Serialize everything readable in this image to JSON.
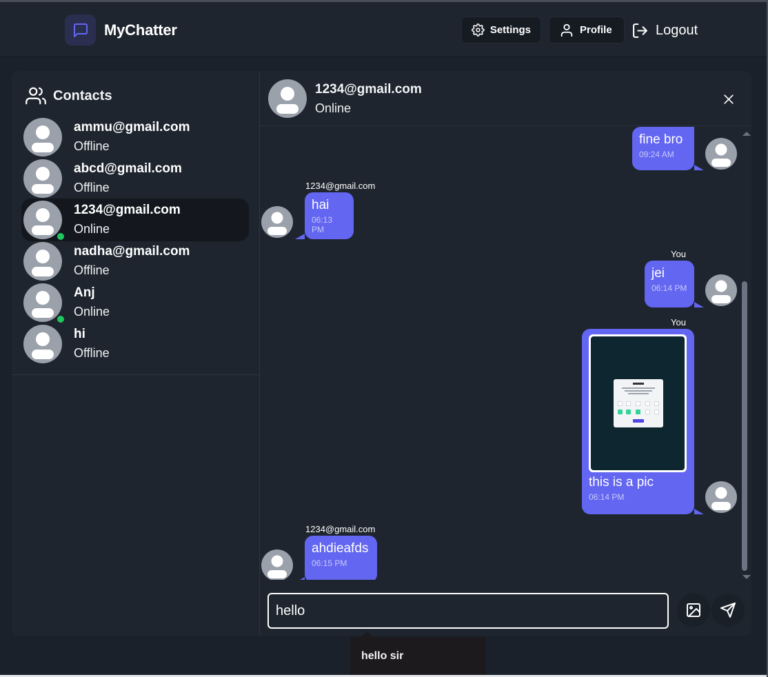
{
  "app": {
    "name": "MyChatter",
    "accent": "#6366f1"
  },
  "navbar": {
    "settings_label": "Settings",
    "profile_label": "Profile",
    "logout_label": "Logout"
  },
  "sidebar": {
    "title": "Contacts",
    "contacts": [
      {
        "name": "ammu@gmail.com",
        "status": "Offline",
        "online": false
      },
      {
        "name": "abcd@gmail.com",
        "status": "Offline",
        "online": false
      },
      {
        "name": "1234@gmail.com",
        "status": "Online",
        "online": true,
        "selected": true
      },
      {
        "name": "nadha@gmail.com",
        "status": "Offline",
        "online": false
      },
      {
        "name": "Anj",
        "status": "Online",
        "online": true
      },
      {
        "name": "hi",
        "status": "Offline",
        "online": false
      }
    ]
  },
  "chat": {
    "header": {
      "name": "1234@gmail.com",
      "status": "Online"
    },
    "messages": [
      {
        "from": "you",
        "text": "fine bro",
        "time": "09:24 AM"
      },
      {
        "from": "them",
        "sender": "1234@gmail.com",
        "text": "hai",
        "time": "06:13 PM"
      },
      {
        "from": "you",
        "sender": "You",
        "text": "jei",
        "time": "06:14 PM"
      },
      {
        "from": "you",
        "sender": "You",
        "text": "this is a pic",
        "time": "06:14 PM",
        "has_image": true
      },
      {
        "from": "them",
        "sender": "1234@gmail.com",
        "text": "ahdieafds",
        "time": "06:15 PM"
      }
    ],
    "composer": {
      "value": "hello"
    }
  },
  "tooltip": {
    "text": "hello sir"
  }
}
